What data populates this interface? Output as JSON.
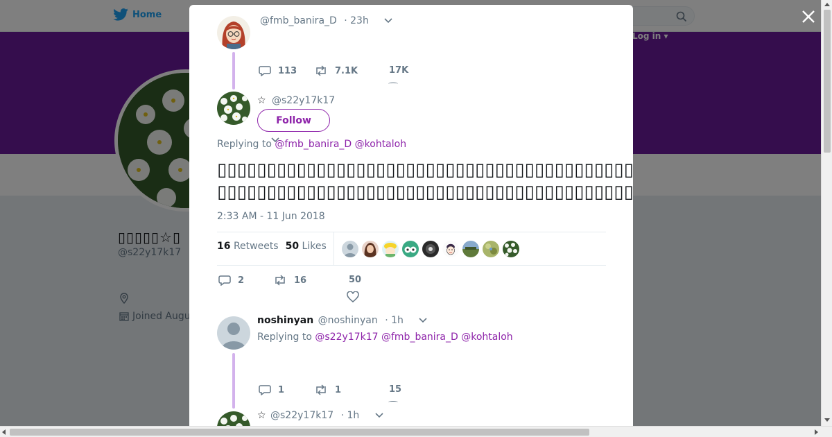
{
  "background": {
    "nav_home_label": "Home",
    "login_label": "Log in",
    "profile_name": "▯▯▯▯▯☆▯",
    "profile_handle": "@s22y17k17",
    "joined_text": "Joined Augu",
    "banner_color": "#6a1b9a"
  },
  "modal": {
    "parent_tweet": {
      "handle": "@fmb_banira_D",
      "time": "· 23h",
      "replies": "113",
      "retweets": "7.1K",
      "likes": "17K"
    },
    "main_tweet": {
      "name": "☆",
      "handle": "@s22y17k17",
      "follow_label": "Follow",
      "replying_prefix": "Replying to",
      "replying_to": [
        "@fmb_banira_D",
        "@kohtaloh"
      ],
      "text_line1": "▯▯▯▯▯▯▯▯▯▯▯▯▯▯▯▯▯▯▯▯▯▯▯▯▯▯▯▯▯▯▯▯▯▯▯▯▯▯▯▯▯▯▯▯▯▯▯▯▯▯▯▯▯▯▯▯▯▯▯▯▯▯▯▯▯▯▯▯▯▯▯▯▯▯▯▯▯▯▯▯▯▯▯▯▯▯▯▯▯▯▯▯▯▯▯▯▯▯▯▯▯▯▯▯▯▯▯▯▯▯▯▯▯▯▯▯▯▯▯▯",
      "text_line2": "▯▯▯▯▯▯▯▯▯▯▯▯▯▯▯▯▯▯▯▯▯▯▯▯▯▯▯▯▯▯▯▯▯▯▯▯▯▯▯▯▯▯▯▯▯▯▯▯▯▯▯▯▯▯▯▯▯▯▯▯▯▯▯▯▯▯▯▯▯▯▯▯▯▯▯▯▯▯▯▯▯▯▯▯▯▯▯▯▯▯▯▯▯",
      "timestamp": "2:33 AM - 11 Jun 2018",
      "retweets_count": "16",
      "retweets_label": "Retweets",
      "likes_count": "50",
      "likes_label": "Likes",
      "replies": "2",
      "retweets": "16",
      "likes": "50"
    },
    "reply_tweet": {
      "name": "noshinyan",
      "handle": "@noshinyan",
      "time": "· 1h",
      "replying_prefix": "Replying to",
      "replying_to": [
        "@s22y17k17",
        "@fmb_banira_D",
        "@kohtaloh"
      ],
      "replies": "1",
      "retweets": "1",
      "likes": "15"
    },
    "next_tweet": {
      "name": "☆",
      "handle": "@s22y17k17",
      "time": "· 1h"
    }
  },
  "colors": {
    "accent": "#8e24aa",
    "thread_line": "#d3b2ec",
    "muted": "#657786"
  }
}
